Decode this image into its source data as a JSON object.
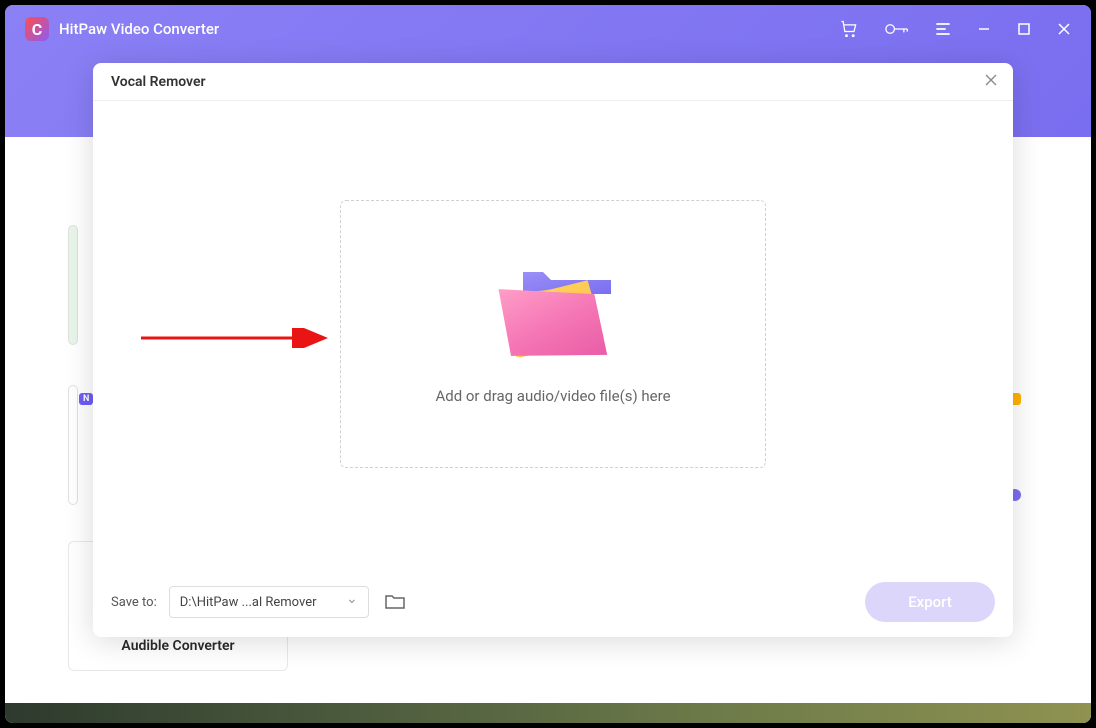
{
  "app": {
    "title": "HitPaw Video Converter",
    "logo_letter": "C"
  },
  "titlebar": {
    "icons": {
      "cart": "cart-icon",
      "key": "key-icon",
      "menu": "menu-icon",
      "minimize": "minimize-icon",
      "maximize": "maximize-icon",
      "close": "close-icon"
    }
  },
  "background": {
    "card3_label": "Audible Converter",
    "new_badge": "N"
  },
  "modal": {
    "title": "Vocal Remover",
    "dropzone_text": "Add or drag audio/video file(s) here",
    "save_to_label": "Save to:",
    "save_path": "D:\\HitPaw ...al Remover",
    "export_label": "Export"
  }
}
